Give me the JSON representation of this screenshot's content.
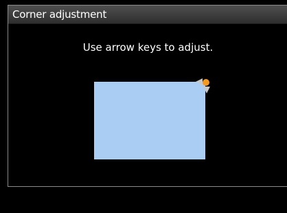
{
  "dialog": {
    "title": "Corner adjustment",
    "instruction": "Use arrow keys to adjust."
  },
  "colors": {
    "background": "#000000",
    "title_bar": "#3f3f3f",
    "screen_preview": "#a9cdf3",
    "selected_corner": "#f39a1f",
    "arrow": "#c8c8c8"
  },
  "icons": {
    "selected_corner": "circle",
    "left_arrow": "left-arrow-icon",
    "down_arrow": "down-arrow-icon"
  }
}
